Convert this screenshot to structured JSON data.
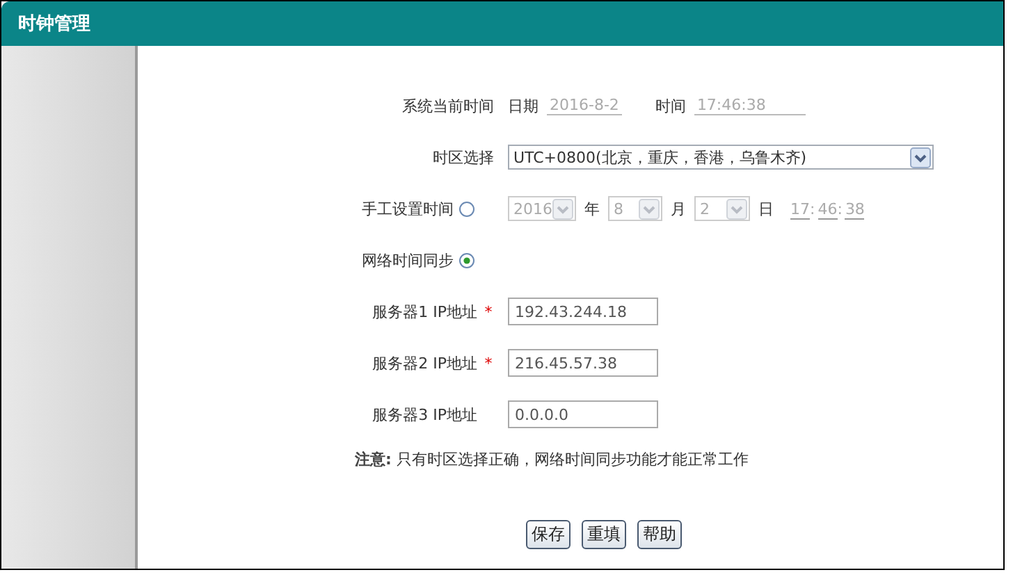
{
  "window": {
    "title": "时钟管理"
  },
  "system_time": {
    "label": "系统当前时间",
    "date_label": "日期",
    "date": "2016-8-2",
    "time_label": "时间",
    "time": "17:46:38"
  },
  "timezone": {
    "label": "时区选择",
    "value": "UTC+0800(北京，重庆，香港，乌鲁木齐)"
  },
  "sync_modes": [
    {
      "kind": "manual",
      "label": "手工设置时间",
      "selected": false,
      "fields_disabled": true,
      "year": "2016",
      "year_unit": "年",
      "month": "8",
      "month_unit": "月",
      "day": "2",
      "day_unit": "日",
      "time_fields": [
        {
          "value": "17",
          "separator": ":"
        },
        {
          "value": "46",
          "separator": ":"
        },
        {
          "value": "38"
        }
      ]
    },
    {
      "kind": "network",
      "label": "网络时间同步",
      "selected": true
    }
  ],
  "servers": [
    {
      "label": "服务器1 IP地址",
      "required_mark": "*",
      "value": "192.43.244.18"
    },
    {
      "label": "服务器2 IP地址",
      "required_mark": "*",
      "value": "216.45.57.38"
    },
    {
      "label": "服务器3 IP地址",
      "value": "0.0.0.0"
    }
  ],
  "note": {
    "label": "注意:",
    "text": "只有时区选择正确，网络时间同步功能才能正常工作"
  },
  "buttons": [
    "保存",
    "重填",
    "帮助"
  ]
}
